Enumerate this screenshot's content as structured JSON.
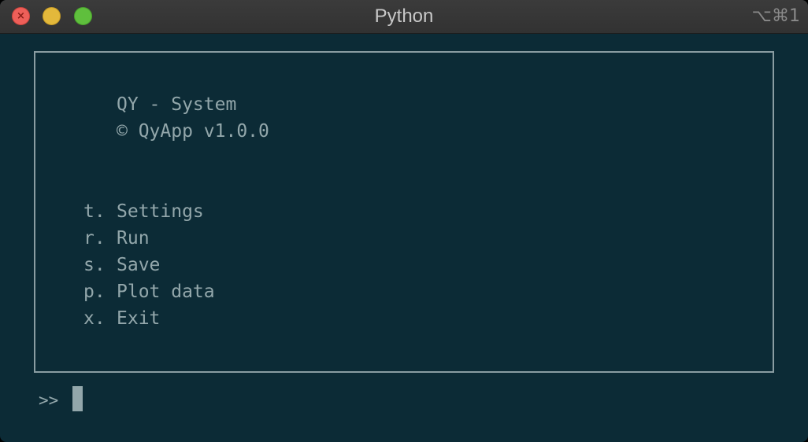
{
  "window": {
    "title": "Python",
    "shortcut": "⌥⌘1",
    "close_glyph": "×"
  },
  "header": {
    "line1": "QY - System",
    "line2": "© QyApp v1.0.0"
  },
  "menu": {
    "items": [
      {
        "key": "t.",
        "label": "Settings"
      },
      {
        "key": "r.",
        "label": "Run"
      },
      {
        "key": "s.",
        "label": "Save"
      },
      {
        "key": "p.",
        "label": "Plot data"
      },
      {
        "key": "x.",
        "label": "Exit"
      }
    ]
  },
  "prompt": {
    "symbol": ">>"
  },
  "colors": {
    "background": "#0c2b36",
    "text": "#93a7ab",
    "border": "#8a9da2"
  }
}
